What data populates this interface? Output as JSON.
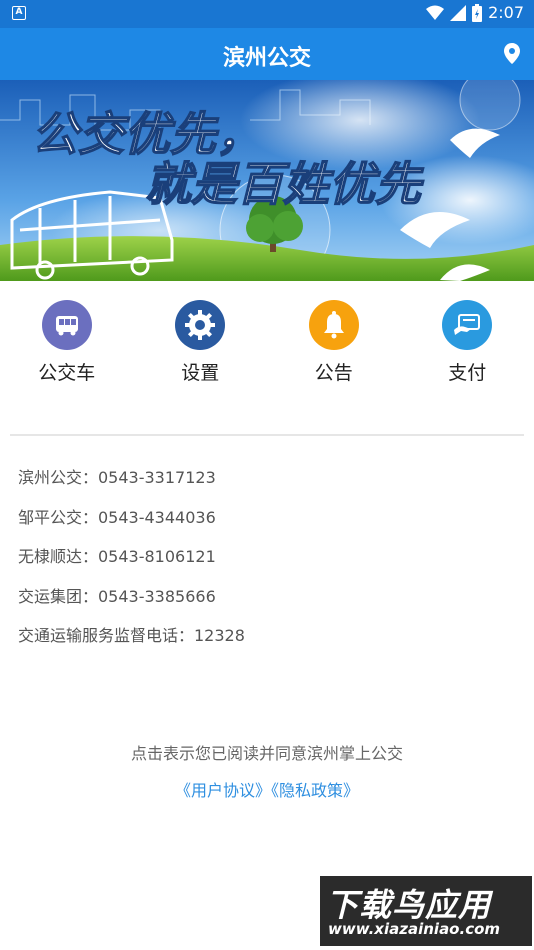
{
  "status_bar": {
    "time": "2:07",
    "notification_icon": "A"
  },
  "header": {
    "title": "滨州公交",
    "location_icon": "location-pin-icon"
  },
  "banner": {
    "line1": "公交优先，",
    "line2": "就是百姓优先"
  },
  "menu": [
    {
      "label": "公交车",
      "icon": "bus-icon",
      "color": "#6b6fbf"
    },
    {
      "label": "设置",
      "icon": "gear-icon",
      "color": "#2a5aa0"
    },
    {
      "label": "公告",
      "icon": "bell-icon",
      "color": "#f7a20e"
    },
    {
      "label": "支付",
      "icon": "card-icon",
      "color": "#2a9adf"
    }
  ],
  "contacts": [
    {
      "text": "滨州公交：0543-3317123"
    },
    {
      "text": "邹平公交：0543-4344036"
    },
    {
      "text": "无棣顺达：0543-8106121"
    },
    {
      "text": "交运集团：0543-3385666"
    },
    {
      "text": "交通运输服务监督电话：12328"
    }
  ],
  "agreement": {
    "text": "点击表示您已阅读并同意滨州掌上公交",
    "user_agreement": "《用户协议》",
    "privacy_policy": "《隐私政策》"
  },
  "watermark": {
    "title": "下载鸟应用",
    "url": "www.xiazainiao.com"
  }
}
